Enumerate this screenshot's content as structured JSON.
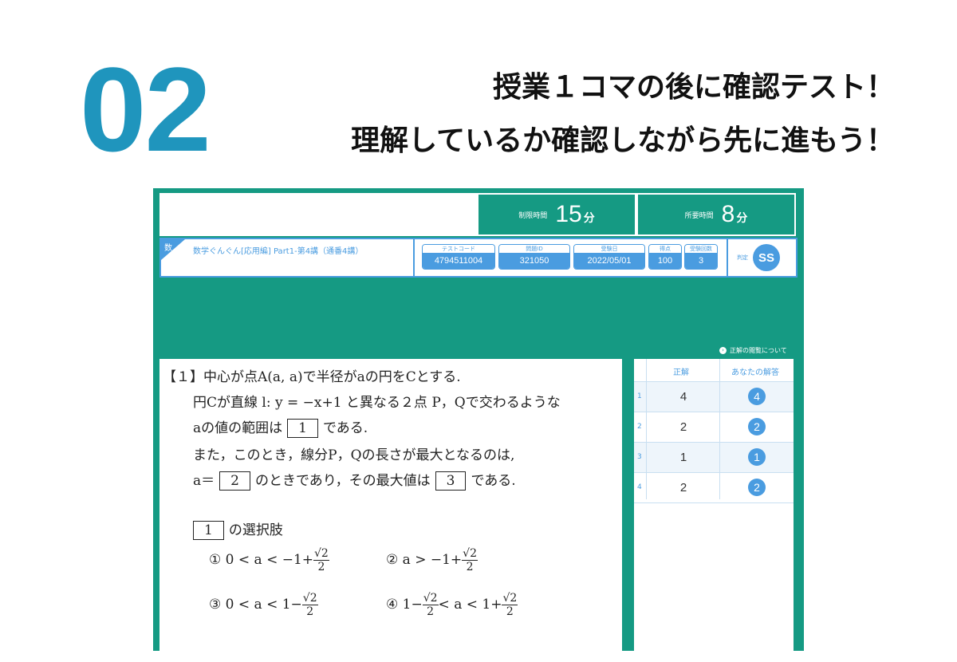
{
  "step_number": "02",
  "headline": {
    "line1": "授業１コマの後に確認テスト！",
    "line2": "理解しているか確認しながら先に進もう！"
  },
  "app": {
    "time_limit": {
      "label": "制限時間",
      "value": "15",
      "unit": "分"
    },
    "time_spent": {
      "label": "所要時間",
      "value": "8",
      "unit": "分"
    },
    "subject_badge": "数",
    "course_title": "数学ぐんぐん[応用編] Part1-第4講（通番4講）",
    "fields": [
      {
        "label": "テストコード",
        "value": "4794511004"
      },
      {
        "label": "問題ID",
        "value": "321050"
      },
      {
        "label": "受験日",
        "value": "2022/05/01"
      },
      {
        "label": "得点",
        "value": "100"
      },
      {
        "label": "受験回数",
        "value": "3"
      }
    ],
    "verdict": {
      "label": "判定",
      "value": "SS"
    },
    "answer_note": "正解の閲覧について",
    "colors": {
      "green": "#159a83",
      "blue": "#4a9ce0"
    }
  },
  "question": {
    "number": "【１】",
    "line1": "中心が点A(a, a)で半径がaの円をCとする.",
    "line2": "円Cが直線 l: y = −x+1 と異なる２点 P，Qで交わるような",
    "line3_pre": "aの値の範囲は",
    "line3_post": "である.",
    "line4": "また，このとき，線分P，Qの長さが最大となるのは,",
    "line5_pre": "a＝",
    "line5_mid": "のときであり，その最大値は",
    "line5_post": "である.",
    "box1": "1",
    "box2": "2",
    "box3": "3",
    "choices_heading_box": "1",
    "choices_heading": "の選択肢",
    "choices": [
      {
        "mark": "①",
        "pre": "0 < a < −1+",
        "num": "√2",
        "den": "2"
      },
      {
        "mark": "②",
        "pre": "a > −1+",
        "num": "√2",
        "den": "2"
      },
      {
        "mark": "③",
        "pre": "0 < a < 1−",
        "num": "√2",
        "den": "2"
      },
      {
        "mark": "④",
        "pre": "1−",
        "num": "√2",
        "den": "2",
        "post": "< a < 1+",
        "num2": "√2",
        "den2": "2"
      }
    ]
  },
  "answers": {
    "header_correct": "正解",
    "header_yours": "あなたの解答",
    "rows": [
      {
        "index": "1",
        "correct": "4",
        "yours": "4"
      },
      {
        "index": "2",
        "correct": "2",
        "yours": "2"
      },
      {
        "index": "3",
        "correct": "1",
        "yours": "1"
      },
      {
        "index": "4",
        "correct": "2",
        "yours": "2"
      }
    ]
  }
}
